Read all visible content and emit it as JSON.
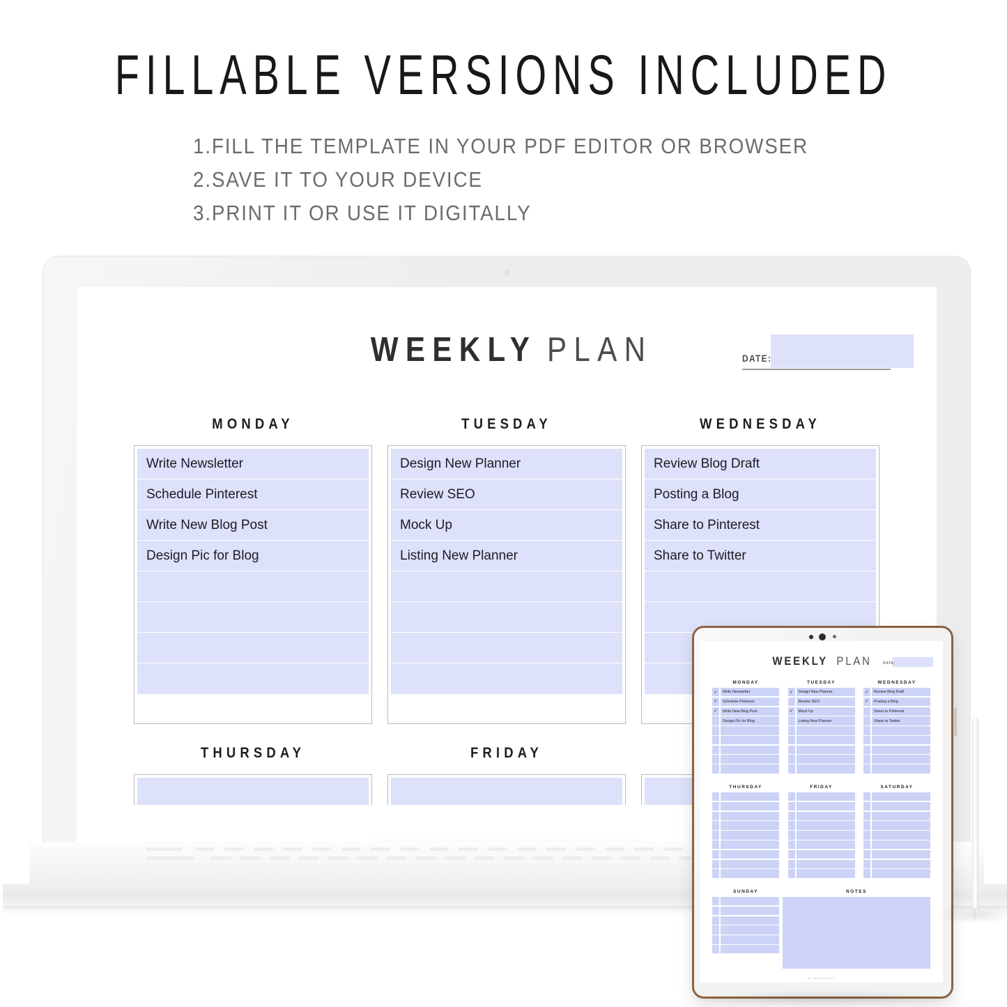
{
  "headline": "FILLABLE VERSIONS INCLUDED",
  "steps": [
    "1.FILL THE TEMPLATE IN YOUR PDF EDITOR OR BROWSER",
    "2.SAVE IT TO YOUR DEVICE",
    "3.PRINT IT OR USE IT DIGITALLY"
  ],
  "colors": {
    "fill": "#dde1fa",
    "fill_tablet": "#ccd3f7",
    "text": "#1c1c24",
    "laptop_bezel": "#ededed",
    "tablet_frame": "#8a6242"
  },
  "planner": {
    "title_bold": "WEEKLY",
    "title_light": "PLAN",
    "date_label": "DATE:",
    "date_value": "",
    "days": [
      {
        "name": "MONDAY",
        "tasks": [
          "Write Newsletter",
          "Schedule Pinterest",
          "Write New Blog Post",
          "Design Pic for Blog"
        ],
        "empty_rows": 4
      },
      {
        "name": "TUESDAY",
        "tasks": [
          "Design New Planner",
          "Review SEO",
          "Mock Up",
          "Listing New Planner"
        ],
        "empty_rows": 4
      },
      {
        "name": "WEDNESDAY",
        "tasks": [
          "Review Blog Draft",
          "Posting a Blog",
          "Share to Pinterest",
          "Share to Twitter"
        ],
        "empty_rows": 4
      },
      {
        "name": "THURSDAY",
        "tasks": [],
        "empty_rows": 1
      },
      {
        "name": "FRIDAY",
        "tasks": [],
        "empty_rows": 1
      },
      {
        "name": "SATURDAY",
        "tasks": [],
        "empty_rows": 1
      }
    ]
  },
  "tablet": {
    "title_bold": "WEEKLY",
    "title_light": "PLAN",
    "date_label": "DATE:",
    "footer": "BY MONIDECT",
    "days": [
      {
        "name": "MONDAY",
        "rows": [
          {
            "text": "Write Newsletter",
            "checked": true
          },
          {
            "text": "Schedule Pinterest",
            "checked": true
          },
          {
            "text": "Write New Blog Post",
            "checked": true
          },
          {
            "text": "Design Pic for Blog",
            "checked": false
          },
          {
            "text": "",
            "checked": false
          },
          {
            "text": "",
            "checked": false
          },
          {
            "text": "",
            "checked": false
          },
          {
            "text": "",
            "checked": false
          },
          {
            "text": "",
            "checked": false
          }
        ]
      },
      {
        "name": "TUESDAY",
        "rows": [
          {
            "text": "Design New Planner",
            "checked": true
          },
          {
            "text": "Review SEO",
            "checked": false
          },
          {
            "text": "Mock Up",
            "checked": true
          },
          {
            "text": "Listing New Planner",
            "checked": false
          },
          {
            "text": "",
            "checked": false
          },
          {
            "text": "",
            "checked": false
          },
          {
            "text": "",
            "checked": false
          },
          {
            "text": "",
            "checked": false
          },
          {
            "text": "",
            "checked": false
          }
        ]
      },
      {
        "name": "WEDNESDAY",
        "rows": [
          {
            "text": "Review Blog Draft",
            "checked": true
          },
          {
            "text": "Posting a Blog",
            "checked": true
          },
          {
            "text": "Share to Pinterest",
            "checked": false
          },
          {
            "text": "Share to Twitter",
            "checked": false
          },
          {
            "text": "",
            "checked": false
          },
          {
            "text": "",
            "checked": false
          },
          {
            "text": "",
            "checked": false
          },
          {
            "text": "",
            "checked": false
          },
          {
            "text": "",
            "checked": false
          }
        ]
      },
      {
        "name": "THURSDAY",
        "rows": [
          {
            "text": "",
            "checked": false
          },
          {
            "text": "",
            "checked": false
          },
          {
            "text": "",
            "checked": false
          },
          {
            "text": "",
            "checked": false
          },
          {
            "text": "",
            "checked": false
          },
          {
            "text": "",
            "checked": false
          },
          {
            "text": "",
            "checked": false
          },
          {
            "text": "",
            "checked": false
          },
          {
            "text": "",
            "checked": false
          }
        ]
      },
      {
        "name": "FRIDAY",
        "rows": [
          {
            "text": "",
            "checked": false
          },
          {
            "text": "",
            "checked": false
          },
          {
            "text": "",
            "checked": false
          },
          {
            "text": "",
            "checked": false
          },
          {
            "text": "",
            "checked": false
          },
          {
            "text": "",
            "checked": false
          },
          {
            "text": "",
            "checked": false
          },
          {
            "text": "",
            "checked": false
          },
          {
            "text": "",
            "checked": false
          }
        ]
      },
      {
        "name": "SATURDAY",
        "rows": [
          {
            "text": "",
            "checked": false
          },
          {
            "text": "",
            "checked": false
          },
          {
            "text": "",
            "checked": false
          },
          {
            "text": "",
            "checked": false
          },
          {
            "text": "",
            "checked": false
          },
          {
            "text": "",
            "checked": false
          },
          {
            "text": "",
            "checked": false
          },
          {
            "text": "",
            "checked": false
          },
          {
            "text": "",
            "checked": false
          }
        ]
      },
      {
        "name": "SUNDAY",
        "rows": [
          {
            "text": "",
            "checked": false
          },
          {
            "text": "",
            "checked": false
          },
          {
            "text": "",
            "checked": false
          },
          {
            "text": "",
            "checked": false
          },
          {
            "text": "",
            "checked": false
          },
          {
            "text": "",
            "checked": false
          }
        ]
      }
    ],
    "notes_label": "NOTES",
    "check_glyph": "✓"
  }
}
